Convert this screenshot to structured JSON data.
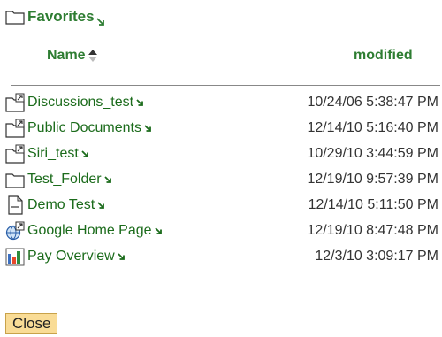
{
  "header": {
    "title": "Favorites"
  },
  "columns": {
    "name": "Name",
    "modified": "modified"
  },
  "rows": [
    {
      "name": "Discussions_test",
      "modified": "10/24/06 5:38:47 PM",
      "icon": "folder-shortcut-icon"
    },
    {
      "name": "Public Documents",
      "modified": "12/14/10 5:16:40 PM",
      "icon": "folder-shortcut-icon"
    },
    {
      "name": "Siri_test",
      "modified": "10/29/10 3:44:59 PM",
      "icon": "folder-shortcut-icon"
    },
    {
      "name": "Test_Folder",
      "modified": "12/19/10 9:57:39 PM",
      "icon": "folder-icon"
    },
    {
      "name": "Demo Test",
      "modified": "12/14/10 5:11:50 PM",
      "icon": "document-icon"
    },
    {
      "name": "Google Home Page",
      "modified": "12/19/10 8:47:48 PM",
      "icon": "web-link-icon"
    },
    {
      "name": "Pay Overview",
      "modified": "12/3/10 3:09:17 PM",
      "icon": "report-icon"
    }
  ],
  "buttons": {
    "close": "Close"
  }
}
